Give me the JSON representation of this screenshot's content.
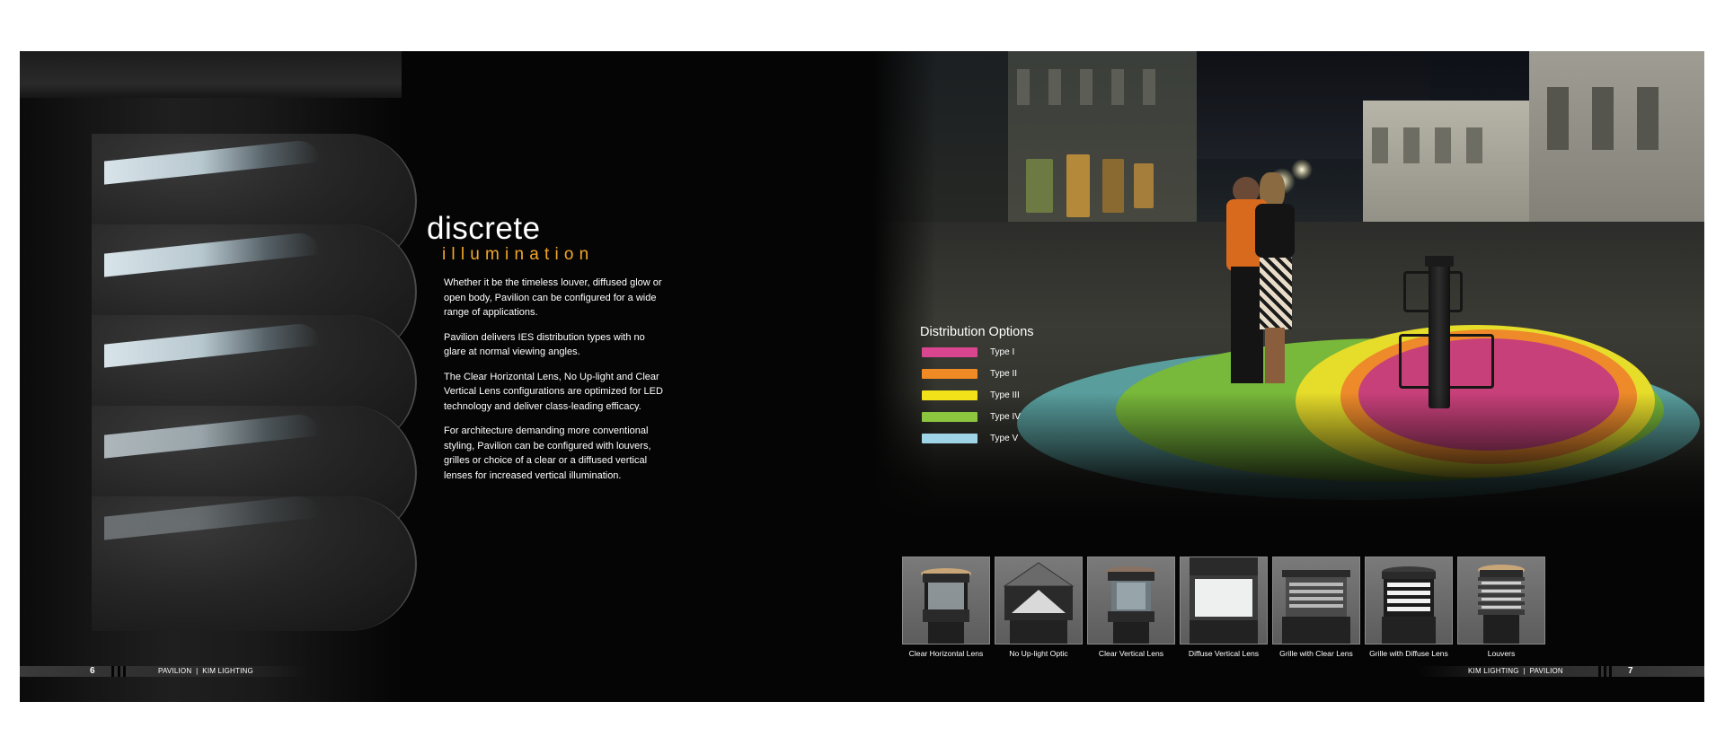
{
  "left_page": {
    "title": "discrete",
    "subtitle": "illumination",
    "paragraphs": [
      "Whether it be the timeless louver, diffused glow or open body, Pavilion can be configured for a wide range of applications.",
      "Pavilion delivers IES distribution types with no glare at normal viewing angles.",
      "The Clear Horizontal Lens, No Up-light and Clear Vertical Lens configurations are optimized for LED technology and deliver class-leading efficacy.",
      "For architecture demanding more conventional styling, Pavilion can be configured with louvers, grilles or choice of a clear or a diffused vertical lenses for increased vertical illumination."
    ],
    "page_number": "6",
    "folio": "PAVILION  |  KIM LIGHTING"
  },
  "right_page": {
    "distribution_title": "Distribution Options",
    "distribution_types": [
      {
        "label": "Type I",
        "color": "#d9458f"
      },
      {
        "label": "Type II",
        "color": "#f08a24"
      },
      {
        "label": "Type III",
        "color": "#f2e21a"
      },
      {
        "label": "Type IV",
        "color": "#8cc63f"
      },
      {
        "label": "Type V",
        "color": "#9fd3e6"
      }
    ],
    "optics": [
      {
        "label": "Clear Horizontal Lens",
        "icon": "clear-horizontal-lens-icon"
      },
      {
        "label": "No Up-light Optic",
        "icon": "no-uplight-optic-icon"
      },
      {
        "label": "Clear Vertical Lens",
        "icon": "clear-vertical-lens-icon"
      },
      {
        "label": "Diffuse Vertical Lens",
        "icon": "diffuse-vertical-lens-icon"
      },
      {
        "label": "Grille with Clear Lens",
        "icon": "grille-clear-lens-icon"
      },
      {
        "label": "Grille with Diffuse Lens",
        "icon": "grille-diffuse-lens-icon"
      },
      {
        "label": "Louvers",
        "icon": "louvers-icon"
      }
    ],
    "page_number": "7",
    "folio": "KIM LIGHTING  |  PAVILION"
  },
  "colors": {
    "accent": "#f2a62a",
    "background": "#050505"
  }
}
